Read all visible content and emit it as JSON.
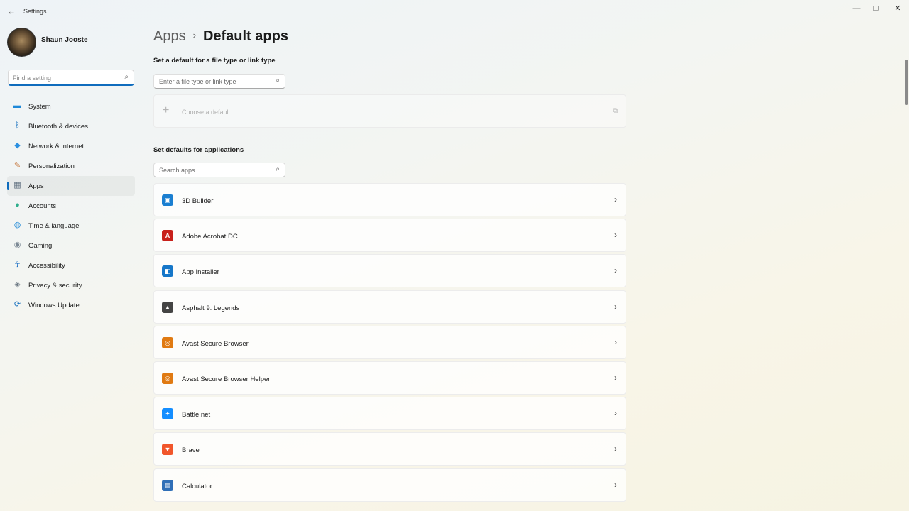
{
  "window": {
    "title": "Settings",
    "back_glyph": "←",
    "minimize_glyph": "—",
    "maximize_glyph": "❐",
    "close_glyph": "✕"
  },
  "profile": {
    "name": "Shaun Jooste"
  },
  "sidebar_search": {
    "placeholder": "Find a setting",
    "icon": "search-icon"
  },
  "nav": [
    {
      "label": "System",
      "icon": "monitor-icon",
      "glyph": "▬",
      "color": "#1e88d8",
      "active": false
    },
    {
      "label": "Bluetooth & devices",
      "icon": "bluetooth-icon",
      "glyph": "ᛒ",
      "color": "#0f6cbd",
      "active": false
    },
    {
      "label": "Network & internet",
      "icon": "wifi-icon",
      "glyph": "◆",
      "color": "#2a8fe0",
      "active": false
    },
    {
      "label": "Personalization",
      "icon": "brush-icon",
      "glyph": "✎",
      "color": "#c26a2a",
      "active": false
    },
    {
      "label": "Apps",
      "icon": "apps-icon",
      "glyph": "▦",
      "color": "#5a6b7c",
      "active": true
    },
    {
      "label": "Accounts",
      "icon": "person-icon",
      "glyph": "●",
      "color": "#2eae8c",
      "active": false
    },
    {
      "label": "Time & language",
      "icon": "globe-clock-icon",
      "glyph": "◍",
      "color": "#2c8fd8",
      "active": false
    },
    {
      "label": "Gaming",
      "icon": "gamepad-icon",
      "glyph": "◉",
      "color": "#7d8a96",
      "active": false
    },
    {
      "label": "Accessibility",
      "icon": "accessibility-icon",
      "glyph": "☥",
      "color": "#1c6fc4",
      "active": false
    },
    {
      "label": "Privacy & security",
      "icon": "shield-icon",
      "glyph": "◈",
      "color": "#6f7b86",
      "active": false
    },
    {
      "label": "Windows Update",
      "icon": "update-icon",
      "glyph": "⟳",
      "color": "#0f6cbd",
      "active": false
    }
  ],
  "breadcrumb": {
    "parent": "Apps",
    "separator": "›",
    "current": "Default apps"
  },
  "file_type_section": {
    "title": "Set a default for a file type or link type",
    "search_placeholder": "Enter a file type or link type",
    "choose_default_label": "Choose a default",
    "plus_glyph": "+",
    "external_glyph": "⧉"
  },
  "apps_section": {
    "title": "Set defaults for applications",
    "search_placeholder": "Search apps"
  },
  "apps": [
    {
      "name": "3D Builder",
      "icon": "3d-builder-icon",
      "glyph": "▣",
      "color": "#1a7fd1"
    },
    {
      "name": "Adobe Acrobat DC",
      "icon": "acrobat-icon",
      "glyph": "A",
      "color": "#c8211b"
    },
    {
      "name": "App Installer",
      "icon": "app-installer-icon",
      "glyph": "◧",
      "color": "#1677c9"
    },
    {
      "name": "Asphalt 9: Legends",
      "icon": "asphalt-icon",
      "glyph": "▲",
      "color": "#444444"
    },
    {
      "name": "Avast Secure Browser",
      "icon": "avast-browser-icon",
      "glyph": "◎",
      "color": "#e07a12"
    },
    {
      "name": "Avast Secure Browser Helper",
      "icon": "avast-helper-icon",
      "glyph": "◎",
      "color": "#e07a12"
    },
    {
      "name": "Battle.net",
      "icon": "battlenet-icon",
      "glyph": "✦",
      "color": "#148eff"
    },
    {
      "name": "Brave",
      "icon": "brave-icon",
      "glyph": "▼",
      "color": "#f1562b"
    },
    {
      "name": "Calculator",
      "icon": "calculator-icon",
      "glyph": "▤",
      "color": "#2f6fb7"
    }
  ],
  "chevron_glyph": "›"
}
